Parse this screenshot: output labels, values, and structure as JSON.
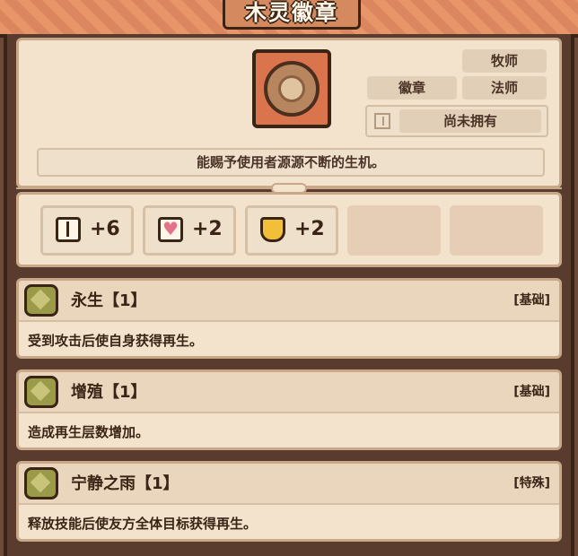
{
  "title": "木灵徽章",
  "item": {
    "icon": "wood-spirit-badge-icon",
    "tags": {
      "class1": "牧师",
      "category": "徽章",
      "class2": "法师"
    },
    "ownership": "尚未拥有",
    "description": "能赐予使用者源源不断的生机。"
  },
  "stats": [
    {
      "icon": "book-icon",
      "value": "+6"
    },
    {
      "icon": "heart-icon",
      "value": "+2"
    },
    {
      "icon": "shield-icon",
      "value": "+2"
    }
  ],
  "skills": [
    {
      "name": "永生【1】",
      "type": "[基础]",
      "description": "受到攻击后使自身获得再生。"
    },
    {
      "name": "增殖【1】",
      "type": "[基础]",
      "description": "造成再生层数增加。"
    },
    {
      "name": "宁静之雨【1】",
      "type": "[特殊]",
      "description": "释放技能后使友方全体目标获得再生。"
    }
  ],
  "colors": {
    "banner": "#e8956a",
    "panel": "#f3e2cc",
    "frame": "#5a3c2e",
    "text": "#3a2416"
  }
}
